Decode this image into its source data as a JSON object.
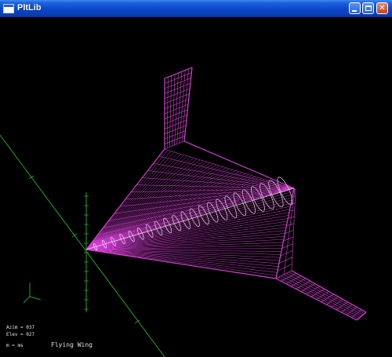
{
  "window": {
    "title": "PltLib",
    "minimize_glyph": "minimize-icon",
    "maximize_glyph": "maximize-icon",
    "close_label": "✕"
  },
  "scene": {
    "model_name": "Flying Wing",
    "status_azim": "Azim = 037",
    "status_elev": "Elev = 027",
    "status_mode": "m = ms",
    "wireframe_color": "#d63fd6",
    "ribs_color": "#f0d8f0",
    "axis_color": "#1fa51f",
    "background_color": "#000000"
  }
}
